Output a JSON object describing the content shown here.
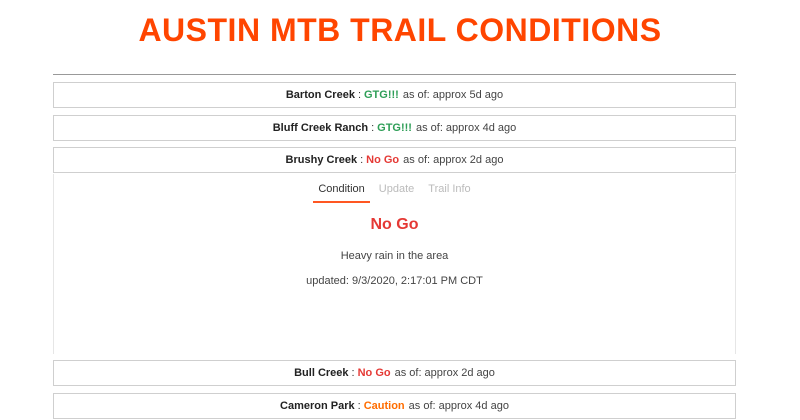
{
  "page": {
    "title": "AUSTIN MTB TRAIL CONDITIONS"
  },
  "colors": {
    "accent": "#ff4500",
    "gtg": "#2e9e57",
    "nogo": "#e53935",
    "caution": "#ff6d00"
  },
  "trails": [
    {
      "name": "Barton Creek",
      "sep": ":",
      "status": "GTG!!!",
      "status_type": "gtg",
      "asof": "as of: approx 5d ago"
    },
    {
      "name": "Bluff Creek Ranch",
      "sep": ":",
      "status": "GTG!!!",
      "status_type": "gtg",
      "asof": "as of: approx 4d ago"
    },
    {
      "name": "Brushy Creek",
      "sep": ":",
      "status": "No Go",
      "status_type": "nogo",
      "asof": "as of: approx 2d ago",
      "expanded": true
    },
    {
      "name": "Bull Creek",
      "sep": ":",
      "status": "No Go",
      "status_type": "nogo",
      "asof": "as of: approx 2d ago"
    },
    {
      "name": "Cameron Park",
      "sep": ":",
      "status": "Caution",
      "status_type": "caution",
      "asof": "as of: approx 4d ago"
    }
  ],
  "detail": {
    "tabs": [
      {
        "label": "Condition",
        "active": true
      },
      {
        "label": "Update",
        "active": false
      },
      {
        "label": "Trail Info",
        "active": false
      }
    ],
    "condition": "No Go",
    "description": "Heavy rain in the area",
    "updated": "updated: 9/3/2020, 2:17:01 PM CDT"
  }
}
